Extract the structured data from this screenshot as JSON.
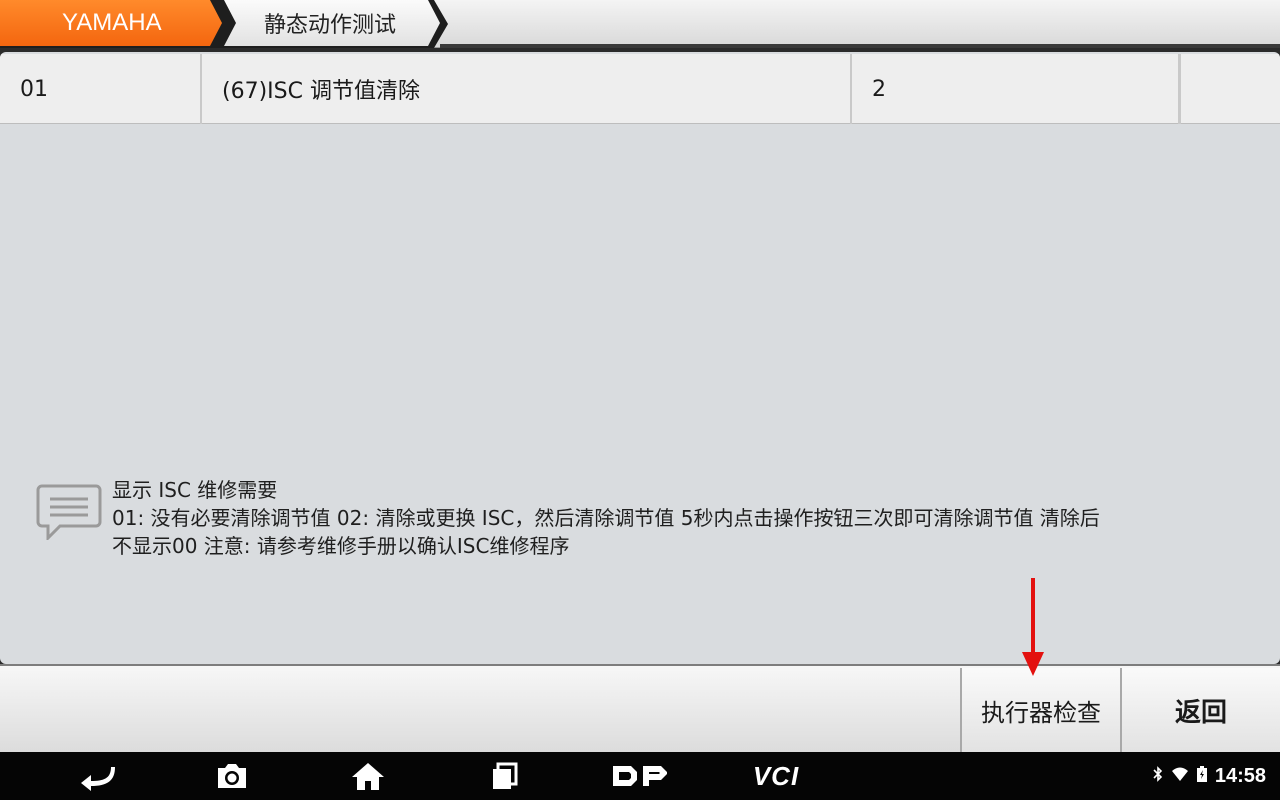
{
  "breadcrumb": {
    "brand": "YAMAHA",
    "page": "静态动作测试"
  },
  "table": {
    "row": {
      "id": "01",
      "name": "(67)ISC 调节值清除",
      "value": "2",
      "extra": ""
    }
  },
  "message": {
    "line1": "显示 ISC 维修需要",
    "line2": "01: 没有必要清除调节值 02: 清除或更换 ISC，然后清除调节值 5秒内点击操作按钮三次即可清除调节值 清除后",
    "line3": "不显示00 注意: 请参考维修手册以确认ISC维修程序"
  },
  "buttons": {
    "execute": "执行器检查",
    "back": "返回"
  },
  "navbar": {
    "icons": [
      "back-icon",
      "camera-icon",
      "home-icon",
      "recent-apps-icon",
      "dp-logo-icon",
      "vci-icon"
    ],
    "vci_label": "VCI",
    "dp_label": "DP",
    "time": "14:58"
  },
  "colors": {
    "brand_orange": "#f4660f",
    "annotation_red": "#e3110f"
  }
}
